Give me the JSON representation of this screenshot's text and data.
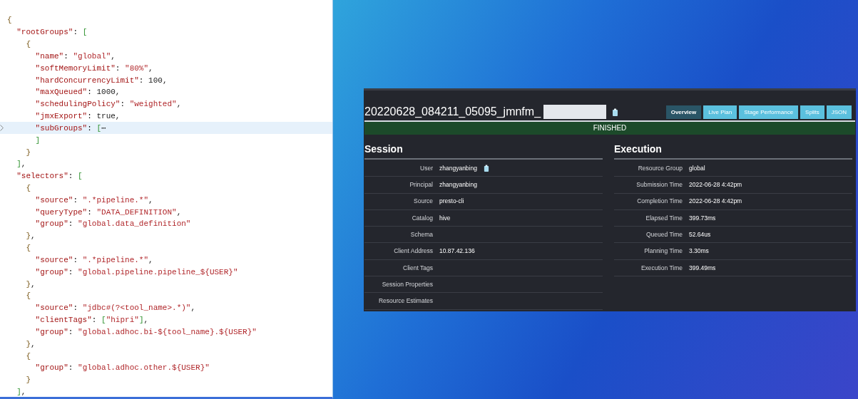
{
  "editor": {
    "lines": [
      {
        "text": "{",
        "selected": false
      },
      {
        "text": "  \"rootGroups\": [",
        "selected": false
      },
      {
        "text": "    {",
        "selected": false
      },
      {
        "text": "      \"name\": \"global\",",
        "selected": false
      },
      {
        "text": "      \"softMemoryLimit\": \"80%\",",
        "selected": false
      },
      {
        "text": "      \"hardConcurrencyLimit\": 100,",
        "selected": false
      },
      {
        "text": "      \"maxQueued\": 1000,",
        "selected": false
      },
      {
        "text": "      \"schedulingPolicy\": \"weighted\",",
        "selected": false
      },
      {
        "text": "      \"jmxExport\": true,",
        "selected": false
      },
      {
        "text": "      \"subGroups\": [⋯",
        "selected": true
      },
      {
        "text": "      ]",
        "selected": false
      },
      {
        "text": "    }",
        "selected": false
      },
      {
        "text": "  ],",
        "selected": false
      },
      {
        "text": "  \"selectors\": [",
        "selected": false
      },
      {
        "text": "    {",
        "selected": false
      },
      {
        "text": "      \"source\": \".*pipeline.*\",",
        "selected": false
      },
      {
        "text": "      \"queryType\": \"DATA_DEFINITION\",",
        "selected": false
      },
      {
        "text": "      \"group\": \"global.data_definition\"",
        "selected": false
      },
      {
        "text": "    },",
        "selected": false
      },
      {
        "text": "    {",
        "selected": false
      },
      {
        "text": "      \"source\": \".*pipeline.*\",",
        "selected": false
      },
      {
        "text": "      \"group\": \"global.pipeline.pipeline_${USER}\"",
        "selected": false
      },
      {
        "text": "    },",
        "selected": false
      },
      {
        "text": "    {",
        "selected": false
      },
      {
        "text": "      \"source\": \"jdbc#(?<tool_name>.*)\",",
        "selected": false
      },
      {
        "text": "      \"clientTags\": [\"hipri\"],",
        "selected": false
      },
      {
        "text": "      \"group\": \"global.adhoc.bi-${tool_name}.${USER}\"",
        "selected": false
      },
      {
        "text": "    },",
        "selected": false
      },
      {
        "text": "    {",
        "selected": false
      },
      {
        "text": "      \"group\": \"global.adhoc.other.${USER}\"",
        "selected": false
      },
      {
        "text": "    }",
        "selected": false
      },
      {
        "text": "  ],",
        "selected": false
      }
    ]
  },
  "query_page": {
    "query_id": "20220628_084211_05095_jmnfm_",
    "tabs": [
      {
        "label": "Overview",
        "selected": true
      },
      {
        "label": "Live Plan",
        "selected": false
      },
      {
        "label": "Stage Performance",
        "selected": false
      },
      {
        "label": "Splits",
        "selected": false
      },
      {
        "label": "JSON",
        "selected": false
      }
    ],
    "state": "FINISHED",
    "session": {
      "title": "Session",
      "rows": [
        {
          "label": "User",
          "value": "zhangyanbing",
          "copyable": true
        },
        {
          "label": "Principal",
          "value": "zhangyanbing"
        },
        {
          "label": "Source",
          "value": "presto-cli"
        },
        {
          "label": "Catalog",
          "value": "hive"
        },
        {
          "label": "Schema"
        },
        {
          "label": "Client Address",
          "value": "10.87.42.136"
        },
        {
          "label": "Client Tags"
        },
        {
          "label": "Session Properties"
        },
        {
          "label": "Resource Estimates"
        }
      ]
    },
    "execution": {
      "title": "Execution",
      "rows": [
        {
          "label": "Resource Group",
          "value": "global"
        },
        {
          "label": "Submission Time",
          "value": "2022-06-28 4:42pm"
        },
        {
          "label": "Completion Time",
          "value": "2022-06-28 4:42pm"
        },
        {
          "label": "Elapsed Time",
          "value": "399.73ms"
        },
        {
          "label": "Queued Time",
          "value": "52.64us"
        },
        {
          "label": "Planning Time",
          "value": "3.30ms"
        },
        {
          "label": "Execution Time",
          "value": "399.49ms"
        }
      ]
    }
  }
}
